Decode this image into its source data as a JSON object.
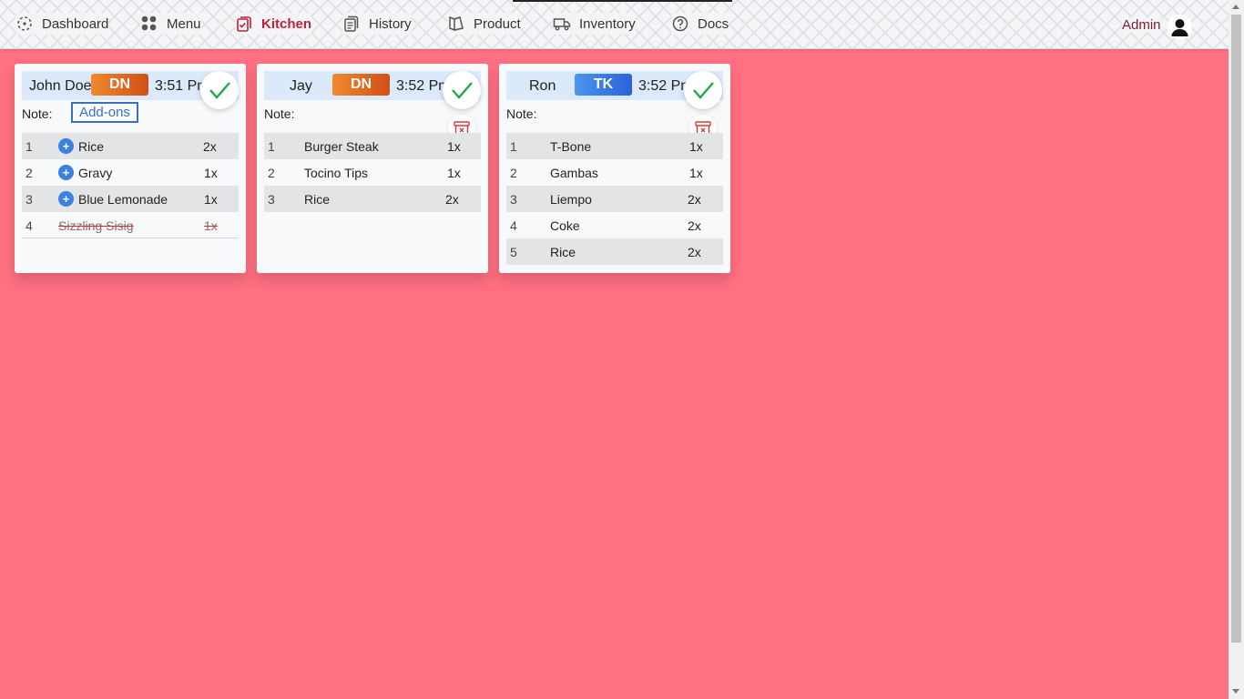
{
  "nav": {
    "items": [
      {
        "label": "Dashboard",
        "icon": "dashboard-icon"
      },
      {
        "label": "Menu",
        "icon": "grid-icon"
      },
      {
        "label": "Kitchen",
        "icon": "clipboard-check-icon",
        "active": true
      },
      {
        "label": "History",
        "icon": "copy-icon"
      },
      {
        "label": "Product",
        "icon": "product-icon"
      },
      {
        "label": "Inventory",
        "icon": "truck-icon"
      },
      {
        "label": "Docs",
        "icon": "help-circle-icon"
      }
    ],
    "user_label": "Admin",
    "active_color": "#c0213a"
  },
  "colors": {
    "background": "#ff7082",
    "dine_in": "#e0691f",
    "take_out": "#3b7fe6",
    "done": "#22a84a",
    "void": "#d93838"
  },
  "orders": [
    {
      "customer": "John Doe",
      "type": "DN",
      "time": "3:51 Pm",
      "note_label": "Note:",
      "addons_label": "Add-ons",
      "items": [
        {
          "no": "1",
          "name": "Rice",
          "qty": "2x",
          "addon": true
        },
        {
          "no": "2",
          "name": "Gravy",
          "qty": "1x",
          "addon": true
        },
        {
          "no": "3",
          "name": "Blue Lemonade",
          "qty": "1x",
          "addon": true
        },
        {
          "no": "4",
          "name": "Sizzling Sisig",
          "qty": "1x",
          "voided": true
        }
      ]
    },
    {
      "customer": "Jay",
      "type": "DN",
      "time": "3:52 Pm",
      "note_label": "Note:",
      "items": [
        {
          "no": "1",
          "name": "Burger Steak",
          "qty": "1x"
        },
        {
          "no": "2",
          "name": "Tocino Tips",
          "qty": "1x"
        },
        {
          "no": "3",
          "name": "Rice",
          "qty": "2x"
        }
      ]
    },
    {
      "customer": "Ron",
      "type": "TK",
      "time": "3:52 Pm",
      "note_label": "Note:",
      "items": [
        {
          "no": "1",
          "name": "T-Bone",
          "qty": "1x"
        },
        {
          "no": "2",
          "name": "Gambas",
          "qty": "1x"
        },
        {
          "no": "3",
          "name": "Liempo",
          "qty": "2x"
        },
        {
          "no": "4",
          "name": "Coke",
          "qty": "2x"
        },
        {
          "no": "5",
          "name": "Rice",
          "qty": "2x"
        }
      ]
    }
  ]
}
